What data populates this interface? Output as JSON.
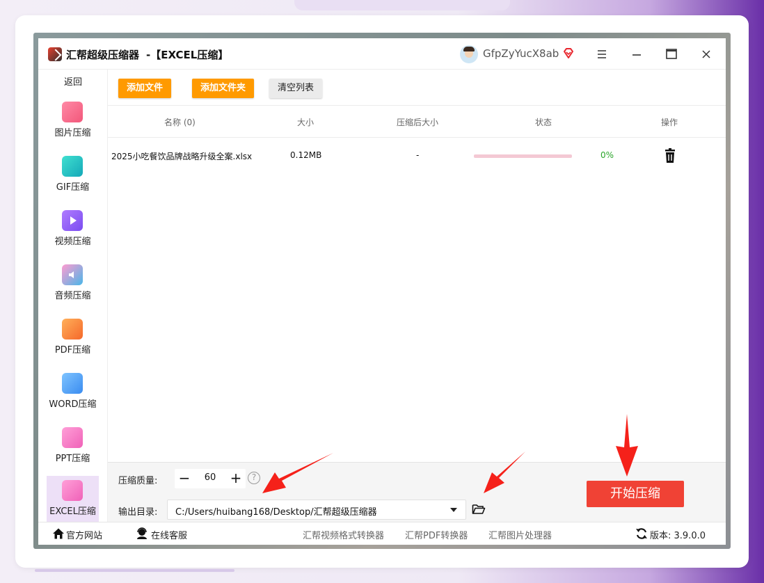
{
  "window": {
    "app_name": "汇帮超级压缩器",
    "subtitle": "-【EXCEL压缩】",
    "username": "GfpZyYucX8ab",
    "icons": [
      "app-logo-icon",
      "avatar",
      "vip-diamond-icon",
      "hamburger-menu-icon",
      "minimize-icon",
      "maximize-icon",
      "close-icon"
    ]
  },
  "sidebar": {
    "back_label": "返回",
    "items": [
      {
        "label": "图片压缩",
        "icon": "image-compress-icon",
        "color": "#f2577a"
      },
      {
        "label": "GIF压缩",
        "icon": "gif-compress-icon",
        "color": "#1ec0c0"
      },
      {
        "label": "视频压缩",
        "icon": "video-compress-icon",
        "color": "#8a5cf0"
      },
      {
        "label": "音频压缩",
        "icon": "audio-compress-icon",
        "color": "#4ab6e8"
      },
      {
        "label": "PDF压缩",
        "icon": "pdf-compress-icon",
        "color": "#f5822a"
      },
      {
        "label": "WORD压缩",
        "icon": "word-compress-icon",
        "color": "#3a8cf0"
      },
      {
        "label": "PPT压缩",
        "icon": "ppt-compress-icon",
        "color": "#f062b8"
      },
      {
        "label": "EXCEL压缩",
        "icon": "excel-compress-icon",
        "color": "#f062b8",
        "active": true
      }
    ]
  },
  "toolbar": {
    "add_file": "添加文件",
    "add_folder": "添加文件夹",
    "clear_list": "清空列表"
  },
  "table": {
    "headers": {
      "name": "名称 (0)",
      "size": "大小",
      "compressed_size": "压缩后大小",
      "status": "状态",
      "action": "操作"
    },
    "rows": [
      {
        "name": "2025小吃餐饮品牌战略升级全案.xlsx",
        "size": "0.12MB",
        "compressed_size": "-",
        "progress": 0,
        "percent": "0%",
        "action_icon": "trash-icon"
      }
    ]
  },
  "settings": {
    "quality_label": "压缩质量:",
    "quality_value": "60",
    "minus": "−",
    "plus": "+",
    "help": "?",
    "output_label": "输出目录:",
    "output_path": "C:/Users/huibang168/Desktop/汇帮超级压缩器",
    "start_button": "开始压缩"
  },
  "statusbar": {
    "website": "官方网站",
    "support": "在线客服",
    "links": [
      "汇帮视频格式转换器",
      "汇帮PDF转换器",
      "汇帮图片处理器"
    ],
    "version": "版本: 3.9.0.0"
  },
  "colors": {
    "accent_orange": "#ff9a00",
    "start_red": "#f04235",
    "active_sidebar": "#ede0f7",
    "progress_track": "#f4c9d4",
    "percent_green": "#2aa52a",
    "annotation_arrow": "#f5211a"
  }
}
